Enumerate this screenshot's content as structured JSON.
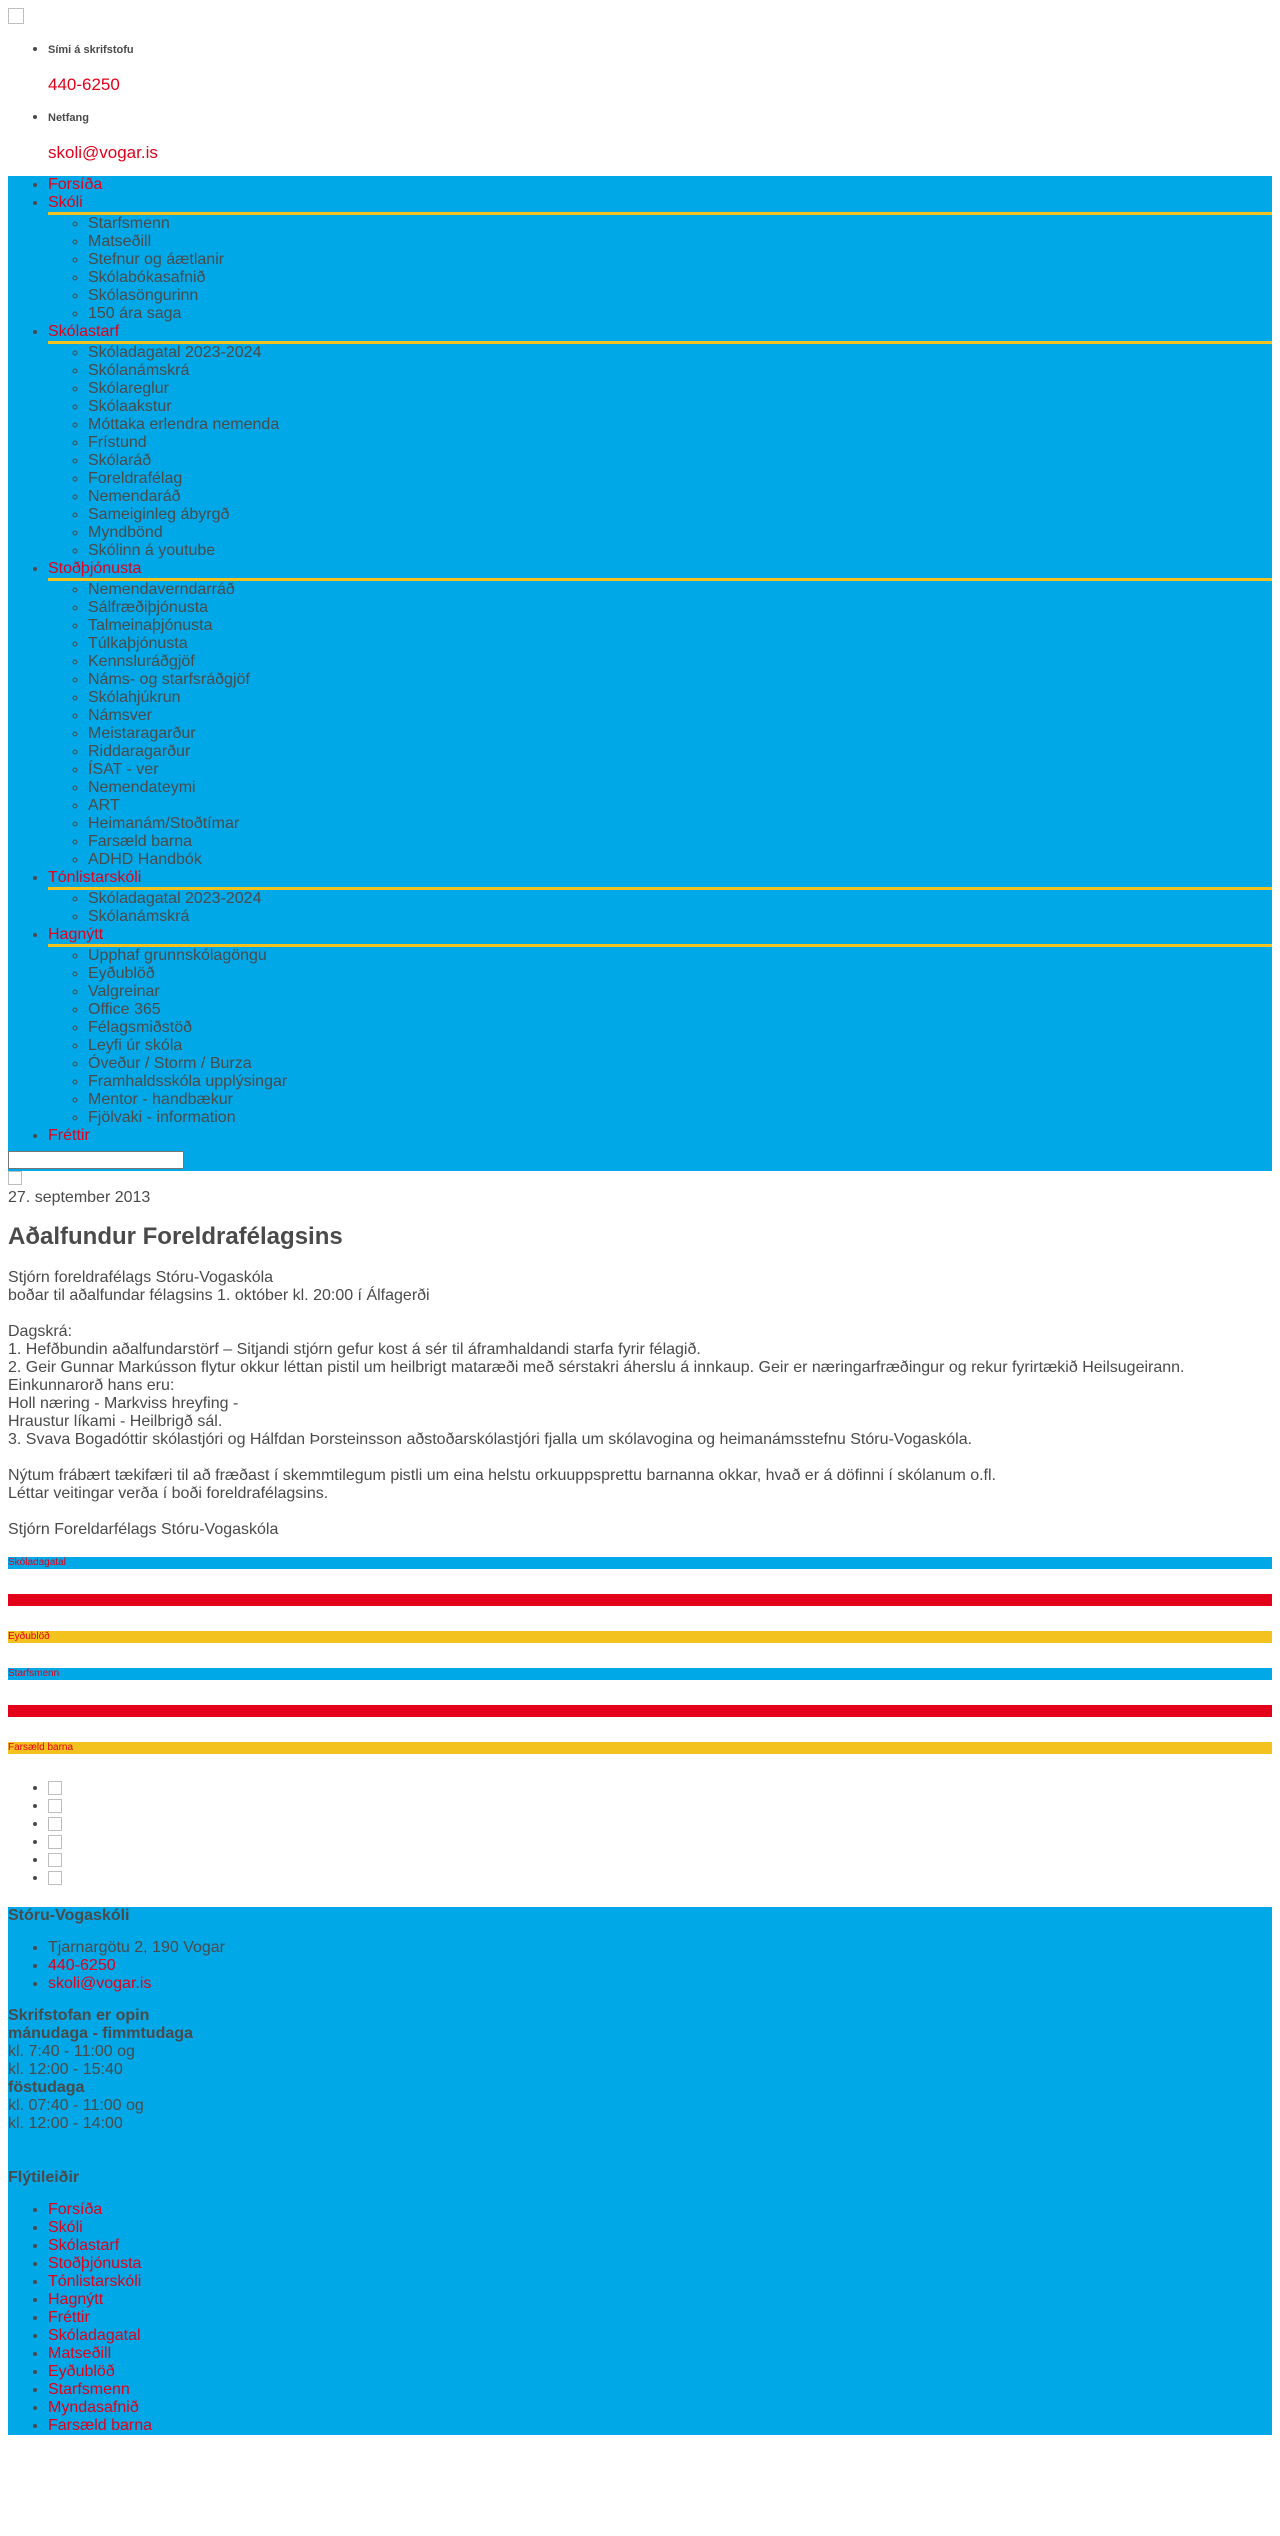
{
  "header": {
    "contact": [
      {
        "label": "Sími á skrifstofu",
        "value": "440-6250"
      },
      {
        "label": "Netfang",
        "value": "skoli@vogar.is"
      }
    ]
  },
  "nav": {
    "items": [
      {
        "label": "Forsíða",
        "sub": []
      },
      {
        "label": "Skóli",
        "sub": [
          "Starfsmenn",
          "Matseðill",
          "Stefnur og áætlanir",
          "Skólabókasafnið",
          "Skólasöngurinn",
          "150 ára saga"
        ]
      },
      {
        "label": "Skólastarf",
        "sub": [
          "Skóladagatal 2023-2024",
          "Skólanámskrá",
          "Skólareglur",
          "Skólaakstur",
          "Móttaka erlendra nemenda",
          "Frístund",
          "Skólaráð",
          "Foreldrafélag",
          "Nemendaráð",
          "Sameiginleg ábyrgð",
          "Myndbönd",
          "Skólinn á youtube"
        ]
      },
      {
        "label": "Stoðþjónusta",
        "sub": [
          "Nemendaverndarráð",
          "Sálfræðiþjónusta",
          "Talmeinaþjónusta",
          "Túlkaþjónusta",
          "Kennsluráðgjöf",
          "Náms- og starfsráðgjöf",
          "Skólahjúkrun",
          "Námsver",
          "Meistaragarður",
          "Riddaragarður",
          "ÍSAT - ver",
          "Nemendateymi",
          "ART",
          "Heimanám/Stoðtímar",
          "Farsæld barna",
          "ADHD Handbók"
        ]
      },
      {
        "label": "Tónlistarskóli",
        "sub": [
          "Skóladagatal 2023-2024",
          "Skólanámskrá"
        ]
      },
      {
        "label": "Hagnýtt",
        "sub": [
          "Upphaf grunnskólagöngu",
          "Eyðublöð",
          "Valgreinar",
          "Office 365",
          "Félagsmiðstöð",
          "Leyfi úr skóla",
          "Óveður / Storm / Burza",
          "Framhaldsskóla upplýsingar",
          "Mentor - handbækur",
          "Fjölvaki - information"
        ]
      },
      {
        "label": "Fréttir",
        "sub": []
      }
    ]
  },
  "article": {
    "date": "27. september 2013",
    "title": "Aðalfundur Foreldrafélagsins",
    "intro1": "Stjórn foreldrafélags Stóru-Vogaskóla",
    "intro2": "boðar til aðalfundar félagsins 1. október kl. 20:00 í Álfagerði",
    "agenda_label": "Dagskrá:",
    "agenda1": "1.  Hefðbundin aðalfundarstörf – Sitjandi stjórn gefur kost á sér til áframhaldandi starfa fyrir félagið.",
    "agenda2": "2.  Geir Gunnar Markússon flytur okkur léttan pistil um heilbrigt mataræði með sérstakri áherslu á innkaup.  Geir er næringarfræðingur og rekur fyrirtækið Heilsugeirann.",
    "motto_label": "Einkunnarorð hans eru:",
    "motto1": "Holl næring - Markviss hreyfing -",
    "motto2": "Hraustur líkami - Heilbrigð sál.",
    "agenda3": "3.  Svava Bogadóttir skólastjóri og Hálfdan Þorsteinsson aðstoðarskólastjóri fjalla um skólavogina og heimanámsstefnu Stóru-Vogaskóla.",
    "closing1": "Nýtum frábært tækifæri til að fræðast í skemmtilegum pistli um eina helstu orkuuppsprettu barnanna okkar, hvað er á döfinni í skólanum o.fl.",
    "closing2": "Léttar veitingar verða í boði foreldrafélagsins.",
    "signature": "Stjórn Foreldarfélags Stóru-Vogaskóla"
  },
  "tiles": [
    {
      "label": "Skóladagatal",
      "color": "#00a8e8"
    },
    {
      "label": "",
      "color": "#e2001a"
    },
    {
      "label": "Eyðublöð",
      "color": "#f4c21f"
    },
    {
      "label": "Starfsmenn",
      "color": "#00a8e8"
    },
    {
      "label": "",
      "color": "#e2001a"
    },
    {
      "label": "Farsæld barna",
      "color": "#f4c21f"
    }
  ],
  "footer": {
    "school_name": "Stóru-Vogaskóli",
    "address": "Tjarnargötu 2, 190 Vogar",
    "phone": "440-6250",
    "email": "skoli@vogar.is",
    "office_heading": "Skrifstofan er opin",
    "weekdays_label": "mánudaga - fimmtudaga",
    "weekdays_hours1": "kl. 7:40 - 11:00 og",
    "weekdays_hours2": "kl. 12:00 - 15:40",
    "friday_label": "föstudaga",
    "friday_hours1": "kl. 07:40 - 11:00 og",
    "friday_hours2": "kl. 12:00 - 14:00",
    "quicklinks_heading": "Flýtileiðir",
    "quicklinks": [
      "Forsíða",
      "Skóli",
      "Skólastarf",
      "Stoðþjónusta",
      "Tónlistarskóli",
      "Hagnýtt",
      "Fréttir",
      "Skóladagatal",
      "Matseðill",
      "Eyðublöð",
      "Starfsmenn",
      "Myndasafnið",
      "Farsæld barna"
    ]
  },
  "colors": {
    "accent_blue": "#00a8e8",
    "link_red": "#e2001a",
    "rule_yellow": "#f4c21f"
  }
}
